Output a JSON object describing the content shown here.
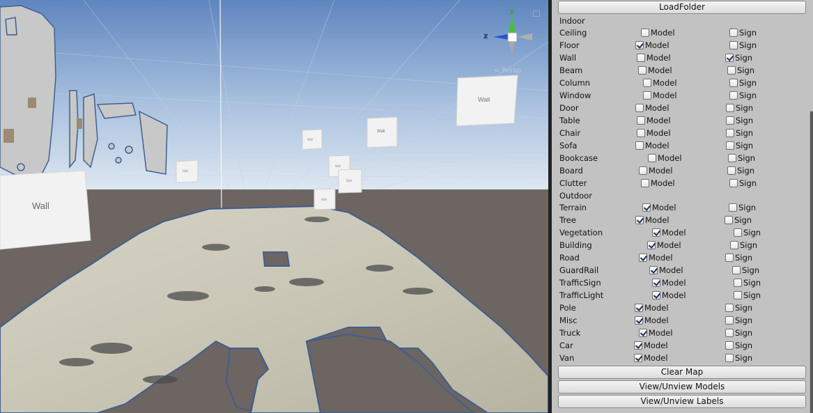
{
  "scene": {
    "wall_labels": [
      "Wall",
      "Wall",
      "Wall"
    ],
    "small_signs": [
      "Wall",
      "Wall",
      "Wall",
      "Wall",
      "Wall"
    ],
    "persp_label": "< Persp",
    "gizmo": {
      "y": "y",
      "z": "z"
    }
  },
  "panel": {
    "load_folder": "LoadFolder",
    "indoor_header": "Indoor",
    "outdoor_header": "Outdoor",
    "indoor": [
      {
        "label": "Ceiling",
        "model": false,
        "sign": false
      },
      {
        "label": "Floor",
        "model": true,
        "sign": false
      },
      {
        "label": "Wall",
        "model": false,
        "sign": true
      },
      {
        "label": "Beam",
        "model": false,
        "sign": false
      },
      {
        "label": "Column",
        "model": false,
        "sign": false
      },
      {
        "label": "Window",
        "model": false,
        "sign": false
      },
      {
        "label": "Door",
        "model": false,
        "sign": false
      },
      {
        "label": "Table",
        "model": false,
        "sign": false
      },
      {
        "label": "Chair",
        "model": false,
        "sign": false
      },
      {
        "label": "Sofa",
        "model": false,
        "sign": false
      },
      {
        "label": "Bookcase",
        "model": false,
        "sign": false
      },
      {
        "label": "Board",
        "model": false,
        "sign": false
      },
      {
        "label": "Clutter",
        "model": false,
        "sign": false
      }
    ],
    "outdoor": [
      {
        "label": "Terrain",
        "model": true,
        "sign": false
      },
      {
        "label": "Tree",
        "model": true,
        "sign": false
      },
      {
        "label": "Vegetation",
        "model": true,
        "sign": false
      },
      {
        "label": "Building",
        "model": true,
        "sign": false
      },
      {
        "label": "Road",
        "model": true,
        "sign": false
      },
      {
        "label": "GuardRail",
        "model": true,
        "sign": false
      },
      {
        "label": "TrafficSign",
        "model": true,
        "sign": false
      },
      {
        "label": "TrafficLight",
        "model": true,
        "sign": false
      },
      {
        "label": "Pole",
        "model": true,
        "sign": false
      },
      {
        "label": "Misc",
        "model": true,
        "sign": false
      },
      {
        "label": "Truck",
        "model": true,
        "sign": false
      },
      {
        "label": "Car",
        "model": true,
        "sign": false
      },
      {
        "label": "Van",
        "model": true,
        "sign": false
      }
    ],
    "model_text": "Model",
    "sign_text": "Sign",
    "clear_map": "Clear Map",
    "view_models": "View/Unview Models",
    "view_labels": "View/Unview Labels"
  }
}
